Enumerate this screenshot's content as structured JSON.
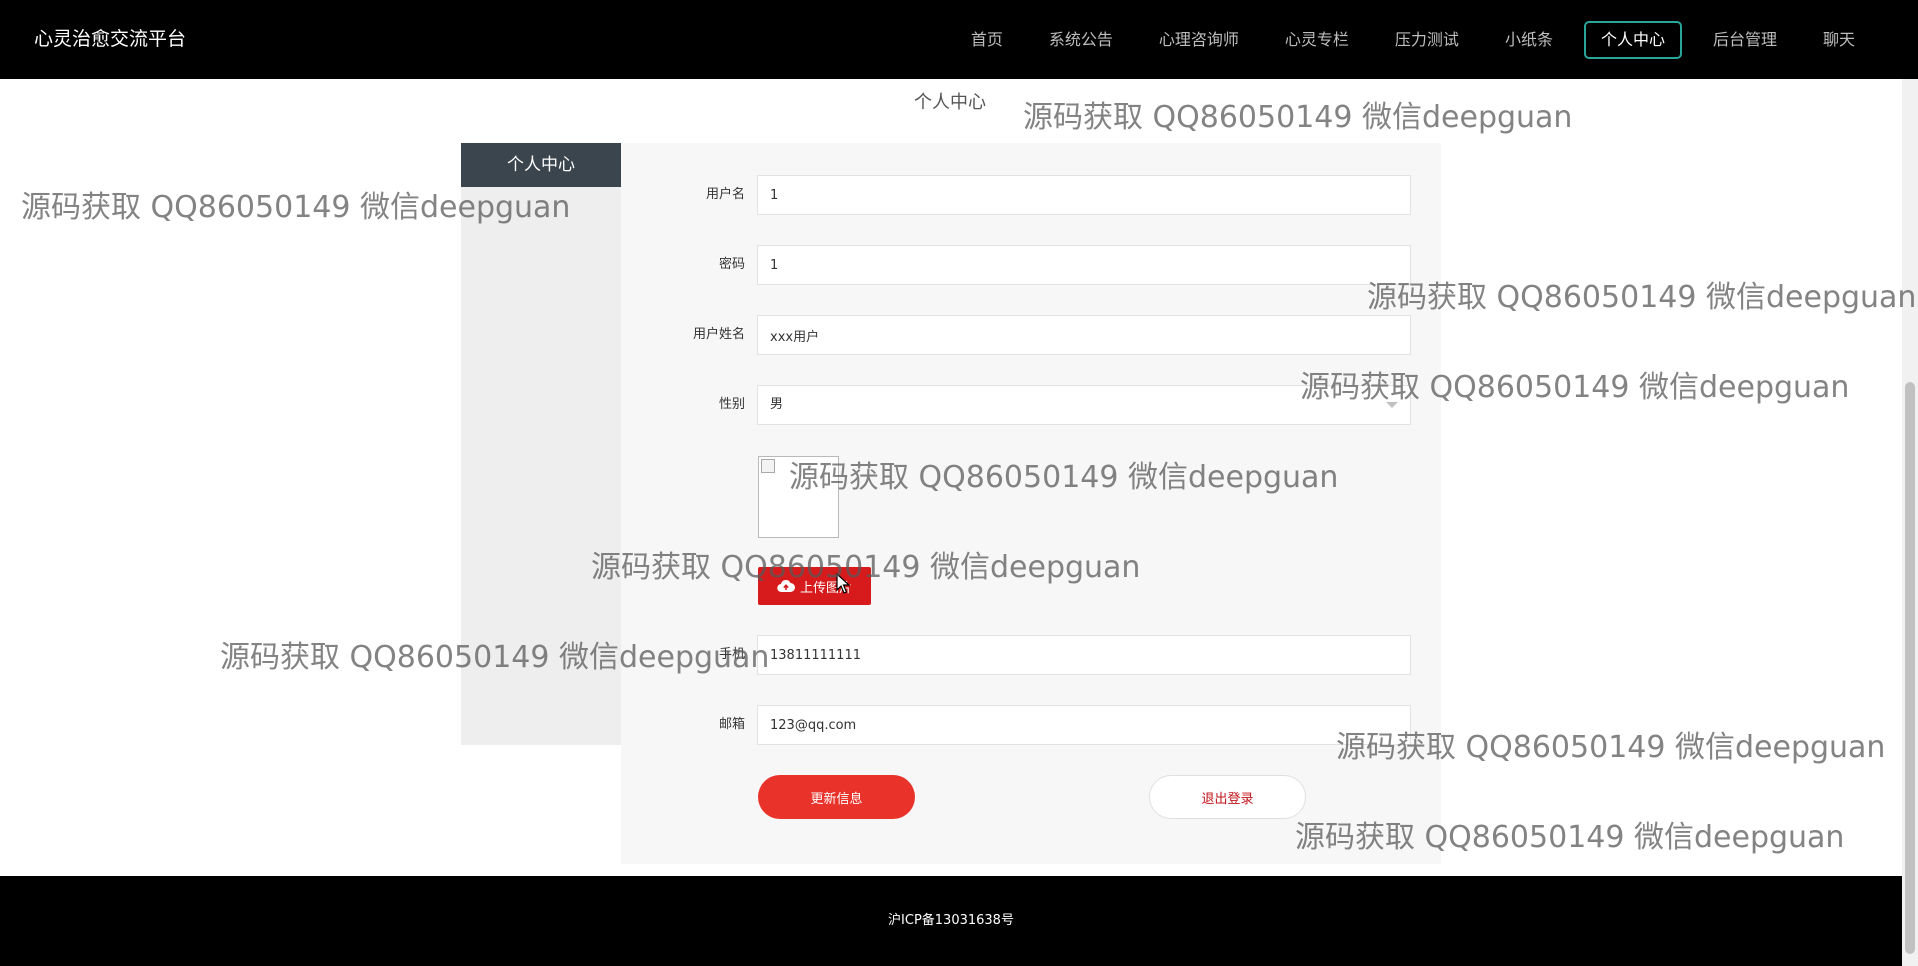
{
  "header": {
    "brand": "心灵治愈交流平台",
    "nav": [
      {
        "label": "首页"
      },
      {
        "label": "系统公告"
      },
      {
        "label": "心理咨询师"
      },
      {
        "label": "心灵专栏"
      },
      {
        "label": "压力测试"
      },
      {
        "label": "小纸条"
      },
      {
        "label": "个人中心",
        "active": true
      },
      {
        "label": "后台管理"
      },
      {
        "label": "聊天"
      }
    ]
  },
  "page": {
    "title": "个人中心"
  },
  "sidebar": {
    "items": [
      {
        "label": "个人中心"
      }
    ]
  },
  "form": {
    "username": {
      "label": "用户名",
      "value": "1"
    },
    "password": {
      "label": "密码",
      "value": "1"
    },
    "fullname": {
      "label": "用户姓名",
      "value": "xxx用户"
    },
    "gender": {
      "label": "性别",
      "value": "男"
    },
    "upload_label": "上传图片",
    "phone": {
      "label": "手机",
      "value": "13811111111"
    },
    "email": {
      "label": "邮箱",
      "value": "123@qq.com"
    },
    "update_label": "更新信息",
    "logout_label": "退出登录"
  },
  "footer": {
    "icp": "沪ICP备13031638号"
  },
  "watermark": "源码获取 QQ86050149 微信deepguan",
  "colors": {
    "header_bg": "#000000",
    "accent_teal": "#2aa59a",
    "primary_red": "#e8322a",
    "sidebar_dark": "#3a454e"
  }
}
